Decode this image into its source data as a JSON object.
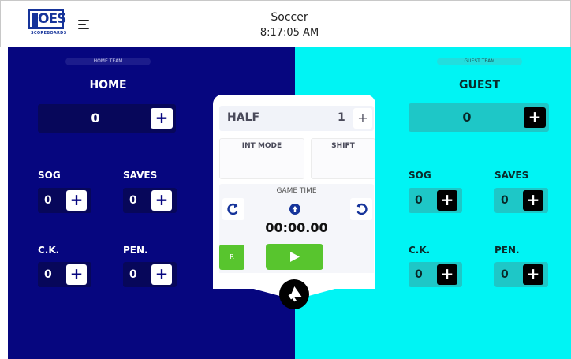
{
  "header": {
    "logo_text": "OES",
    "logo_sub": "SCOREBOARDS",
    "sport": "Soccer",
    "time": "8:17:05 AM"
  },
  "home": {
    "pill": "HOME TEAM",
    "name": "HOME",
    "score": "0",
    "sog_label": "SOG",
    "sog": "0",
    "saves_label": "SAVES",
    "saves": "0",
    "ck_label": "C.K.",
    "ck": "0",
    "pen_label": "PEN.",
    "pen": "0"
  },
  "guest": {
    "pill": "GUEST TEAM",
    "name": "GUEST",
    "score": "0",
    "sog_label": "SOG",
    "sog": "0",
    "saves_label": "SAVES",
    "saves": "0",
    "ck_label": "C.K.",
    "ck": "0",
    "pen_label": "PEN.",
    "pen": "0"
  },
  "center": {
    "half_label": "HALF",
    "half_value": "1",
    "int_mode": "INT MODE",
    "shift": "SHIFT",
    "game_time_label": "GAME TIME",
    "game_time": "00:00.00",
    "reset_label": "R"
  },
  "colors": {
    "home_bg": "#06067f",
    "guest_bg": "#00f4f4",
    "start_green": "#58c52e"
  },
  "icons": {
    "menu": "menu-icon",
    "plus": "plus-icon",
    "redo": "redo-icon",
    "undo": "undo-icon",
    "count_direction": "arrow-up-icon",
    "play": "play-icon",
    "horn": "megaphone-icon"
  }
}
